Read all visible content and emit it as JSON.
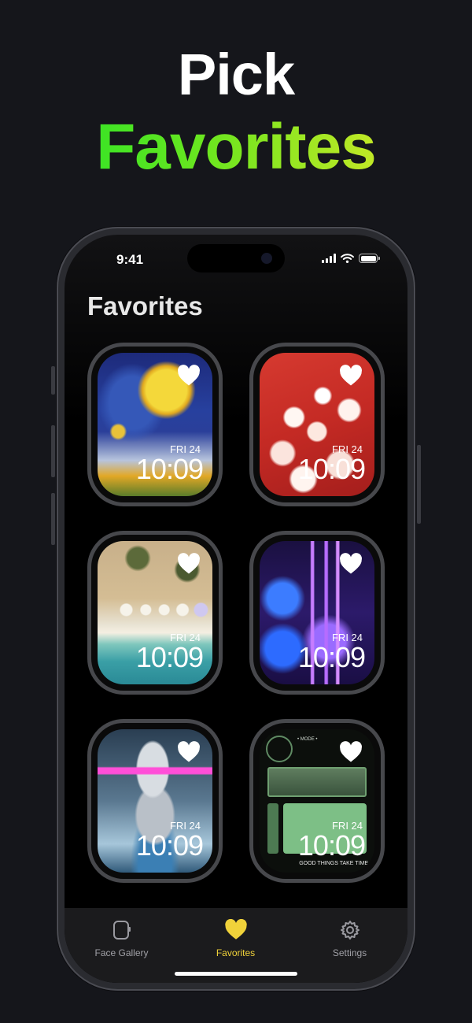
{
  "headline": {
    "line1": "Pick",
    "line2": "Favorites"
  },
  "status": {
    "time": "9:41"
  },
  "page": {
    "title": "Favorites"
  },
  "faces": [
    {
      "name": "starry-night",
      "date": "FRI 24",
      "time": "10:09",
      "favorite": true
    },
    {
      "name": "cherry-blossom",
      "date": "FRI 24",
      "time": "10:09",
      "favorite": true
    },
    {
      "name": "beach-aerial",
      "date": "FRI 24",
      "time": "10:09",
      "favorite": true
    },
    {
      "name": "neon-pc",
      "date": "FRI 24",
      "time": "10:09",
      "favorite": true
    },
    {
      "name": "neon-statue",
      "date": "FRI 24",
      "time": "10:09",
      "favorite": true
    },
    {
      "name": "military-hud",
      "date": "FRI 24",
      "time": "10:09",
      "favorite": true,
      "hud_tagline": "GOOD THINGS TAKE TIME",
      "hud_mode": "• MODE •"
    }
  ],
  "tabs": [
    {
      "label": "Face Gallery",
      "icon": "watch-icon"
    },
    {
      "label": "Favorites",
      "icon": "heart-icon",
      "active": true
    },
    {
      "label": "Settings",
      "icon": "gear-icon"
    }
  ],
  "colors": {
    "accent": "#f0d23a",
    "background": "#15161b",
    "gradient_start": "#14e32a",
    "gradient_end": "#f2e92a"
  }
}
